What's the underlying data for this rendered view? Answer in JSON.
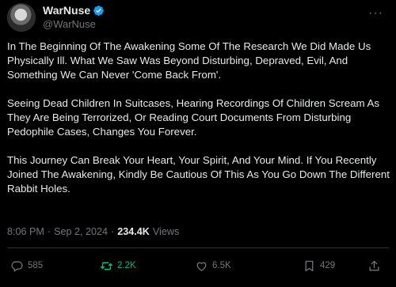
{
  "author": {
    "display_name": "WarNuse",
    "handle": "@WarNuse"
  },
  "tweet": {
    "paragraphs": [
      "In The Beginning Of The Awakening Some Of The Research We Did Made Us Physically Ill. What We Saw Was Beyond Disturbing, Depraved, Evil, And Something We Can Never 'Come Back From'.",
      "Seeing Dead Children In Suitcases, Hearing Recordings Of Children Scream As They Are Being Terrorized, Or Reading Court Documents From Disturbing Pedophile Cases, Changes You Forever.",
      "This Journey Can Break Your Heart, Your Spirit, And Your Mind. If You Recently Joined The Awakening, Kindly Be Cautious Of This As You Go Down The Different Rabbit Holes."
    ],
    "time": "8:06 PM",
    "separator": "·",
    "date": "Sep 2, 2024",
    "views_count": "234.4K",
    "views_label": "Views"
  },
  "actions": {
    "replies": "585",
    "reposts": "2.2K",
    "likes": "6.5K",
    "bookmarks": "429"
  },
  "colors": {
    "background": "#000000",
    "text": "#e7e9ea",
    "muted": "#71767b",
    "verified": "#1d9bf0",
    "repost_active": "#00ba7c"
  },
  "icons": [
    "verified-badge-icon",
    "more-icon",
    "reply-icon",
    "repost-icon",
    "like-icon",
    "bookmark-icon",
    "share-icon"
  ]
}
